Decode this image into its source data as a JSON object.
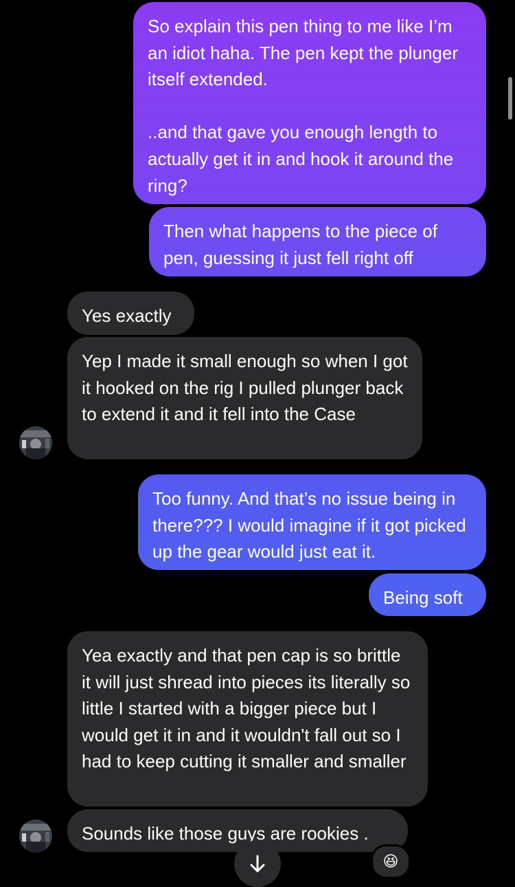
{
  "conversation": {
    "messages": [
      {
        "from": "me",
        "text": "So explain this pen thing to me like I’m an idiot haha. The pen kept the plunger itself extended.\n\n..and that gave you enough length to actually get it in and hook it around the ring?"
      },
      {
        "from": "me",
        "text": "Then what happens to the piece of pen, guessing it just fell right off"
      },
      {
        "from": "them",
        "text": "Yes exactly"
      },
      {
        "from": "them",
        "text": "Yep I made it small enough so when I got it hooked on the rig I pulled plunger back to extend it and it fell into the Case"
      },
      {
        "from": "me",
        "text": "Too funny. And that’s no issue being in there??? I would imagine if it got picked up the gear would just eat it."
      },
      {
        "from": "me",
        "text": "Being soft"
      },
      {
        "from": "them",
        "text": "Yea exactly and that pen cap is so brittle it will just shread into pieces its literally so little I started with a bigger piece but I would get it in and it wouldn't fall out so I had to keep cutting it smaller and smaller"
      },
      {
        "from": "them",
        "text": "Sounds like those guys are rookies ."
      }
    ],
    "reaction_emoji": "😆",
    "scroll_down_icon": "arrow-down-icon",
    "avatar_icon": "contact-avatar"
  },
  "colors": {
    "outgoing_gradient_top": "#8a3df2",
    "outgoing_gradient_bottom": "#4f5ff0",
    "incoming_bubble": "#2b2b2d",
    "background": "#000000"
  }
}
